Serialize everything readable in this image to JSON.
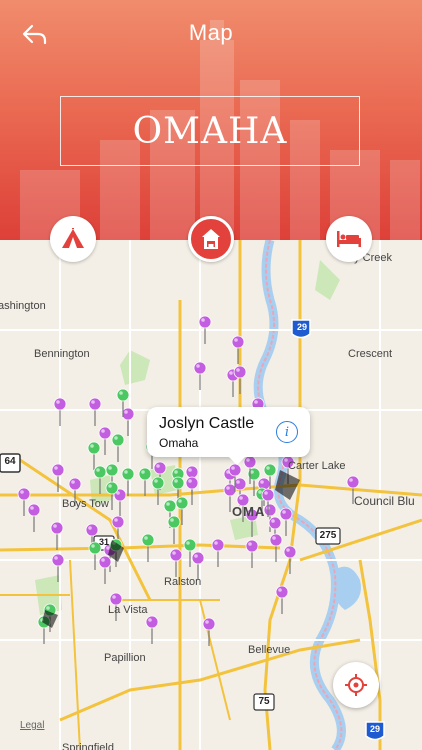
{
  "header": {
    "title": "Map",
    "city": "OMAHA"
  },
  "categories": [
    {
      "name": "tent-icon",
      "active": false
    },
    {
      "name": "hotel-icon",
      "active": true
    },
    {
      "name": "bed-icon",
      "active": false
    }
  ],
  "map_labels": {
    "ashington": "ashington",
    "bennington": "Bennington",
    "crescent": "Crescent",
    "honey_creek": "ey Creek",
    "carter_lake": "Carter Lake",
    "council_bluffs": "Council Blu",
    "boys_town": "Boys Tow",
    "ralston": "Ralston",
    "la_vista": "La Vista",
    "papillion": "Papillion",
    "bellevue": "Bellevue",
    "springfield": "Springfield",
    "omaha_map": "OMA"
  },
  "shields": {
    "i29": "29",
    "i29b": "29",
    "us275": "275",
    "us75": "75",
    "hw64": "64",
    "hw31": "31"
  },
  "callout": {
    "title": "Joslyn Castle",
    "subtitle": "Omaha",
    "info_symbol": "i"
  },
  "legal": "Legal",
  "colors": {
    "header_top": "#f08c6c",
    "header_bottom": "#dd4038",
    "pin_purple": "#c45ee0",
    "pin_green": "#4cc863",
    "accent": "#e3413b"
  }
}
